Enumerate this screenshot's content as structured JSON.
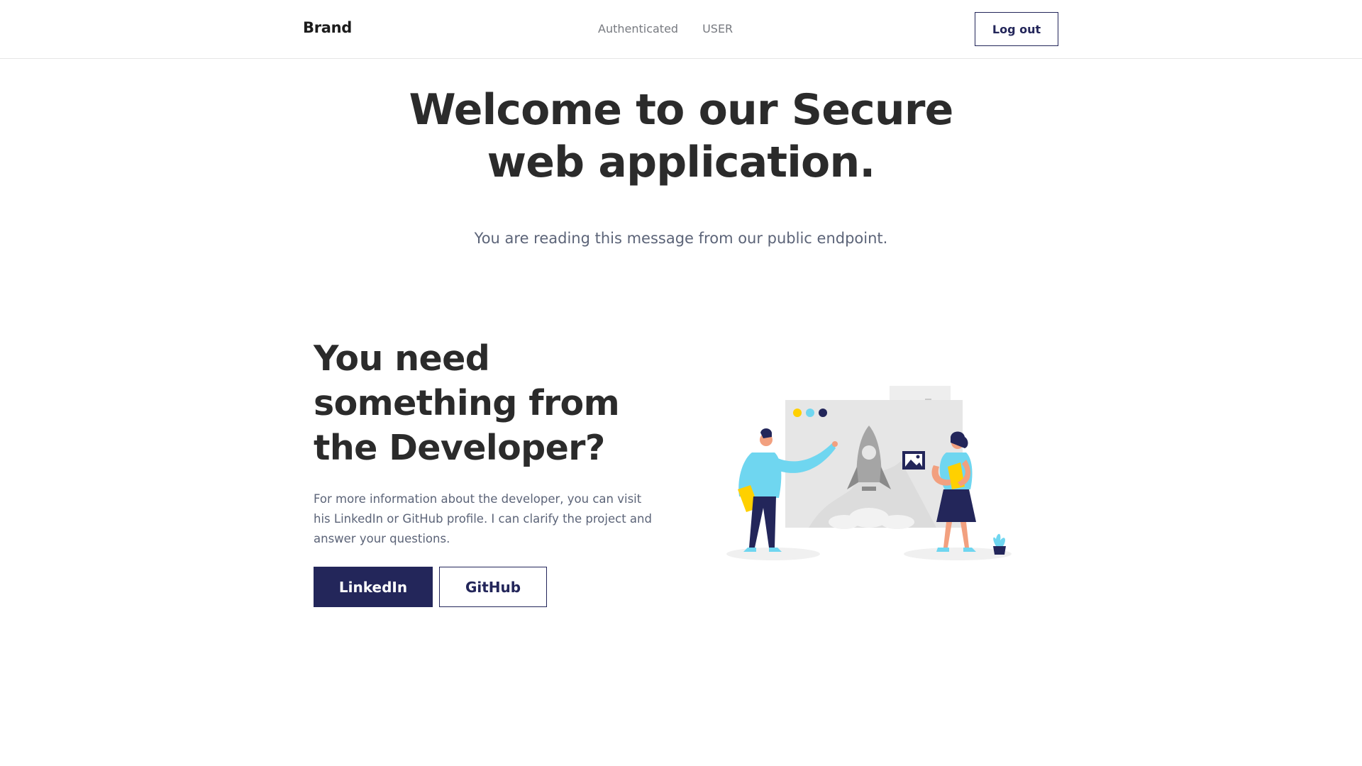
{
  "navbar": {
    "brand": "Brand",
    "links": [
      "Authenticated",
      "USER"
    ],
    "logout_label": "Log out"
  },
  "hero": {
    "title_part1": "Welcome to our ",
    "title_highlight": "Secure",
    "title_part2": "web application.",
    "subtitle": "You are reading this message from our public endpoint."
  },
  "developer": {
    "title_line1": "You need",
    "title_line2": "something from",
    "title_line3_prefix": "the ",
    "title_highlight": "Developer?",
    "description": "For more information about the developer, you can visit his LinkedIn or GitHub profile. I can clarify the project and answer your questions.",
    "linkedin_label": "LinkedIn",
    "github_label": "GitHub"
  },
  "colors": {
    "navy": "#23265a",
    "accent_yellow": "#ffd000",
    "light_blue": "#6fd6f0",
    "text_muted": "#5c6478"
  },
  "icons": {
    "illustration": "rocket-launch-team-illustration"
  }
}
